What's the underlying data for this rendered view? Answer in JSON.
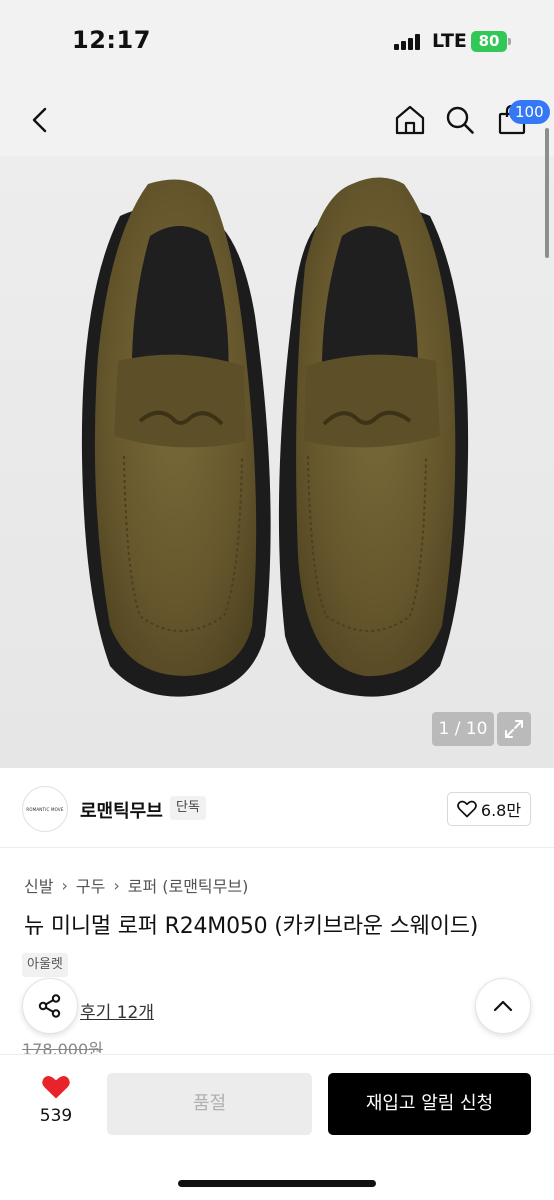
{
  "status": {
    "time": "12:17",
    "network": "LTE",
    "battery": "80"
  },
  "header": {
    "cart_count": "100"
  },
  "image": {
    "counter": "1 / 10"
  },
  "brand": {
    "logo_text": "ROMANTIC MOVE",
    "name": "로맨틱무브",
    "tag": "단독",
    "likes": "6.8만"
  },
  "product": {
    "breadcrumb": [
      "신발",
      "구두",
      "로퍼 (로맨틱무브)"
    ],
    "title": "뉴 미니멀 로퍼 R24M050 (카키브라운 스웨이드)",
    "tag": "아울렛",
    "reviews": "후기 12개",
    "original_price": "178,000원"
  },
  "bottom": {
    "wish_count": "539",
    "soldout_label": "품절",
    "restock_label": "재입고 알림 신청"
  },
  "colors": {
    "accent_blue": "#3478f6",
    "battery_green": "#33c759",
    "heart_red": "#e8232a",
    "suede_khaki": "#6b5a2e"
  }
}
